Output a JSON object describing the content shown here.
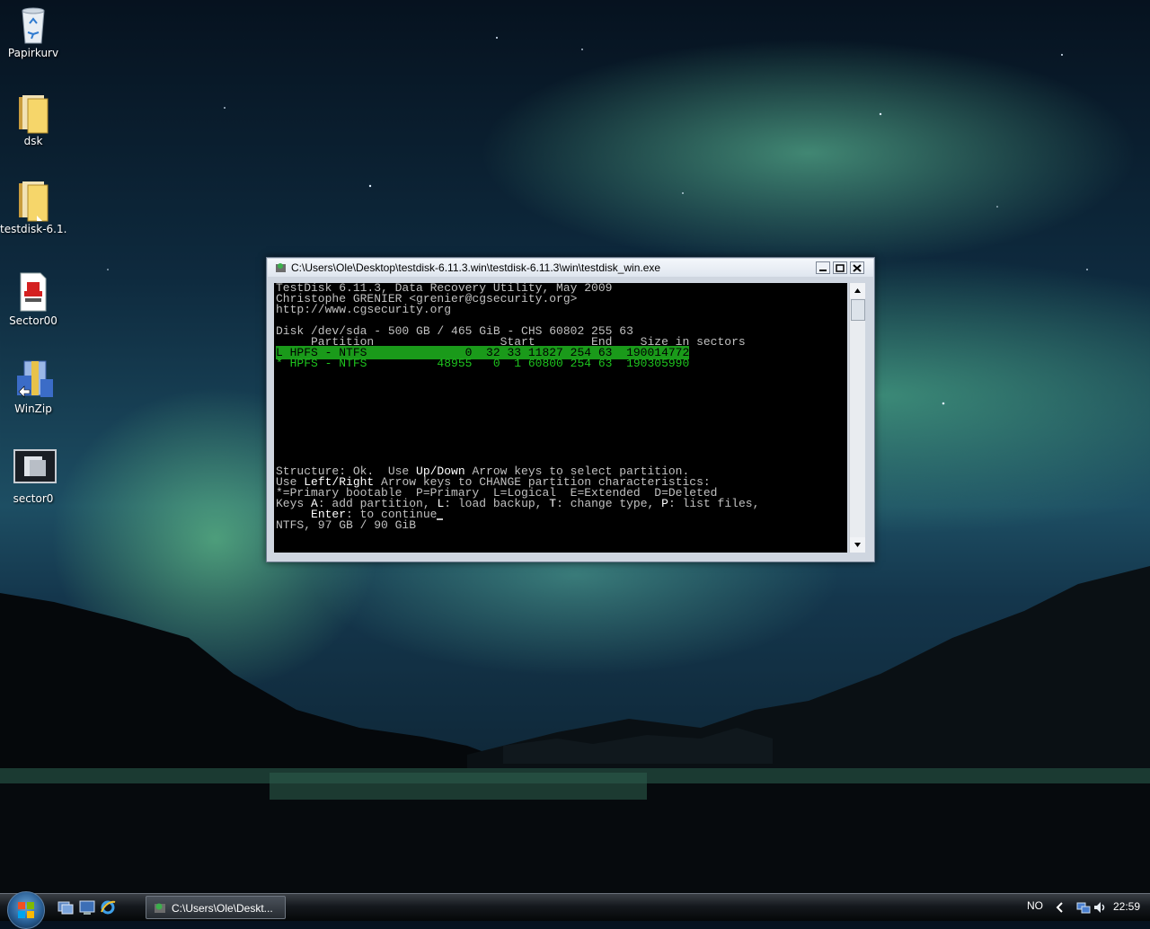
{
  "desktop": {
    "icons": [
      {
        "label": "Papirkurv",
        "icon": "recycle-bin-icon"
      },
      {
        "label": "dsk",
        "icon": "folder-icon"
      },
      {
        "label": "testdisk-6.1...",
        "icon": "folder-icon"
      },
      {
        "label": "Sector00",
        "icon": "document-icon"
      },
      {
        "label": "WinZip",
        "icon": "winzip-icon"
      },
      {
        "label": "sector0",
        "icon": "image-file-icon"
      }
    ]
  },
  "window": {
    "title": "C:\\Users\\Ole\\Desktop\\testdisk-6.11.3.win\\testdisk-6.11.3\\win\\testdisk_win.exe",
    "console": {
      "l1": "TestDisk 6.11.3, Data Recovery Utility, May 2009",
      "l2": "Christophe GRENIER <grenier@cgsecurity.org>",
      "l3": "http://www.cgsecurity.org",
      "disk": "Disk /dev/sda - 500 GB / 465 GiB - CHS 60802 255 63",
      "header": "     Partition                  Start        End    Size in sectors",
      "row1": "L HPFS - NTFS              0  32 33 11827 254 63  190014772",
      "row2": "* HPFS - NTFS          48955   0  1 60800 254 63  190305990",
      "s1a": "Structure: Ok.  Use ",
      "s1b": "Up/Down",
      "s1c": " Arrow keys to select partition.",
      "s2a": "Use ",
      "s2b": "Left/Right",
      "s2c": " Arrow keys to CHANGE partition characteristics:",
      "s3": "*=Primary bootable  P=Primary  L=Logical  E=Extended  D=Deleted",
      "s4a": "Keys ",
      "s4b": "A",
      "s4c": ": add partition, ",
      "s4d": "L",
      "s4e": ": load backup, ",
      "s4f": "T",
      "s4g": ": change type, ",
      "s4h": "P",
      "s4i": ": list files,",
      "s5a": "     ",
      "s5b": "Enter",
      "s5c": ": to continue",
      "s6": "NTFS, 97 GB / 90 GiB"
    }
  },
  "taskbar": {
    "task_label": "C:\\Users\\Ole\\Deskt...",
    "language": "NO",
    "clock": "22:59"
  }
}
